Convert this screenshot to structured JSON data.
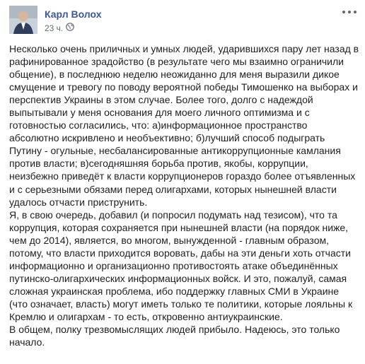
{
  "post": {
    "author": "Карл Волох",
    "time": "23 ч.",
    "icons": {
      "privacy": "globe-icon",
      "menu": "more-options-icon"
    },
    "paragraphs": [
      "Несколько очень приличных и умных людей, ударившихся пару лет назад в рафинированное зрадойство (в результате чего мы взаимно ограничили общение), в последнюю неделю неожиданно для меня выразили дикое смущение и тревогу по поводу вероятной победы Тимошенко на выборах и перспектив Украины в этом случае. Более того, долго с надеждой выпытывали у меня основания для моего личного оптимизма и с готовностью согласились, что: а)информационное пространство абсолютно искривлено и необъективно; б)лучший способ подыграть Путину - огульные, несбалансированные антикоррупционные камлания против власти; в)сегодняшняя борьба против, якобы, коррупции, неизбежно приведёт к власти коррупционеров гораздо более отъявленных и с серьезными обязами перед олигархами, которых нынешней власти удалось отчасти приструнить."
    ],
    "p2_intro": "Я, в свою очередь, добавил (и попросил подумать над тезисом), ",
    "p2_underlined": "что та коррупция, которая сохраняется при нынешней власти (на порядок ниже, чем до 2014), является, во многом, вынужденной - главным образом, потому, что власти приходится воровать, дабы на эти деньги хоть отчасти информационно и организационно противостоять атаке объединённых путинско-олигархических информационных войск.",
    "p2_rest": " И это, пожалуй, самая сложная украинская проблема, ибо поддержку главных СМИ в Украине (что означает, власть) могут иметь только те политики, которые лояльны к Кремлю и олигархам - то есть, откровенно антиукраинские.",
    "p3": "В общем, полку трезвомыслящих людей прибыло. Надеюсь, это только начало.",
    "colors": {
      "author_link": "#385898",
      "underline": "#c00018",
      "text": "#1c1e21",
      "meta": "#616770"
    }
  }
}
